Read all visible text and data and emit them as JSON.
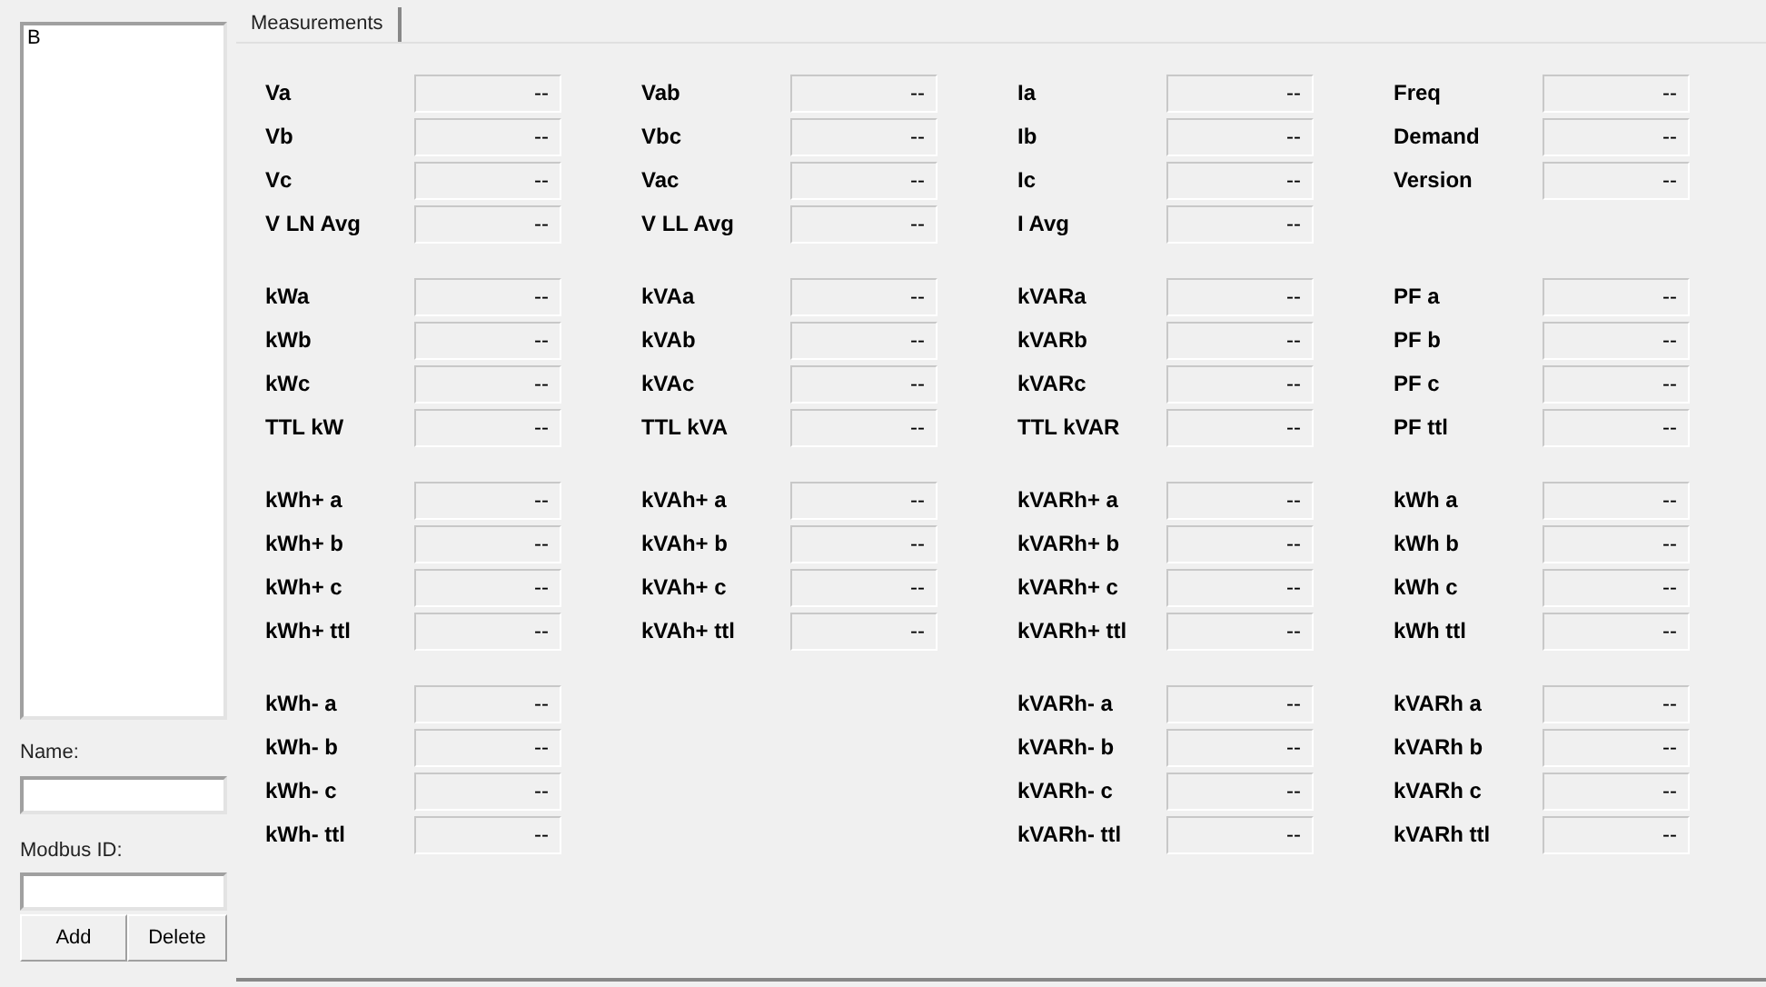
{
  "device_list": {
    "items": [
      {
        "label": "B",
        "selected": false
      }
    ]
  },
  "name_field": {
    "label": "Name:"
  },
  "modbus_field": {
    "label": "Modbus ID:"
  },
  "buttons": [
    "Add",
    "Delete"
  ],
  "tabs": [
    {
      "label": "Measurements",
      "selected": true
    }
  ],
  "groups": [
    {
      "columns": [
        {
          "fields": [
            {
              "label": "Va",
              "value": "--"
            },
            {
              "label": "Vb",
              "value": "--"
            },
            {
              "label": "Vc",
              "value": "--"
            },
            {
              "label": "V LN Avg",
              "value": "--"
            }
          ]
        },
        {
          "fields": [
            {
              "label": "Vab",
              "value": "--"
            },
            {
              "label": "Vbc",
              "value": "--"
            },
            {
              "label": "Vac",
              "value": "--"
            },
            {
              "label": "V LL Avg",
              "value": "--"
            }
          ]
        },
        {
          "fields": [
            {
              "label": "Ia",
              "value": "--"
            },
            {
              "label": "Ib",
              "value": "--"
            },
            {
              "label": "Ic",
              "value": "--"
            },
            {
              "label": "I Avg",
              "value": "--"
            }
          ]
        },
        {
          "fields": [
            {
              "label": "Freq",
              "value": "--"
            },
            {
              "label": "Demand",
              "value": "--"
            },
            {
              "label": "Version",
              "value": "--"
            }
          ]
        }
      ]
    },
    {
      "columns": [
        {
          "fields": [
            {
              "label": "kWa",
              "value": "--"
            },
            {
              "label": "kWb",
              "value": "--"
            },
            {
              "label": "kWc",
              "value": "--"
            },
            {
              "label": "TTL kW",
              "value": "--"
            }
          ]
        },
        {
          "fields": [
            {
              "label": "kVAa",
              "value": "--"
            },
            {
              "label": "kVAb",
              "value": "--"
            },
            {
              "label": "kVAc",
              "value": "--"
            },
            {
              "label": "TTL kVA",
              "value": "--"
            }
          ]
        },
        {
          "fields": [
            {
              "label": "kVARa",
              "value": "--"
            },
            {
              "label": "kVARb",
              "value": "--"
            },
            {
              "label": "kVARc",
              "value": "--"
            },
            {
              "label": "TTL kVAR",
              "value": "--"
            }
          ]
        },
        {
          "fields": [
            {
              "label": "PF a",
              "value": "--"
            },
            {
              "label": "PF b",
              "value": "--"
            },
            {
              "label": "PF c",
              "value": "--"
            },
            {
              "label": "PF ttl",
              "value": "--"
            }
          ]
        }
      ]
    },
    {
      "columns": [
        {
          "fields": [
            {
              "label": "kWh+ a",
              "value": "--"
            },
            {
              "label": "kWh+ b",
              "value": "--"
            },
            {
              "label": "kWh+ c",
              "value": "--"
            },
            {
              "label": "kWh+ ttl",
              "value": "--"
            }
          ]
        },
        {
          "fields": [
            {
              "label": "kVAh+ a",
              "value": "--"
            },
            {
              "label": "kVAh+ b",
              "value": "--"
            },
            {
              "label": "kVAh+ c",
              "value": "--"
            },
            {
              "label": "kVAh+ ttl",
              "value": "--"
            }
          ]
        },
        {
          "fields": [
            {
              "label": "kVARh+ a",
              "value": "--"
            },
            {
              "label": "kVARh+ b",
              "value": "--"
            },
            {
              "label": "kVARh+ c",
              "value": "--"
            },
            {
              "label": "kVARh+ ttl",
              "value": "--"
            }
          ]
        },
        {
          "fields": [
            {
              "label": "kWh a",
              "value": "--"
            },
            {
              "label": "kWh b",
              "value": "--"
            },
            {
              "label": "kWh c",
              "value": "--"
            },
            {
              "label": "kWh ttl",
              "value": "--"
            }
          ]
        }
      ]
    },
    {
      "columns": [
        {
          "fields": [
            {
              "label": "kWh- a",
              "value": "--"
            },
            {
              "label": "kWh- b",
              "value": "--"
            },
            {
              "label": "kWh- c",
              "value": "--"
            },
            {
              "label": "kWh- ttl",
              "value": "--"
            }
          ]
        },
        {},
        {
          "fields": [
            {
              "label": "kVARh- a",
              "value": "--"
            },
            {
              "label": "kVARh- b",
              "value": "--"
            },
            {
              "label": "kVARh- c",
              "value": "--"
            },
            {
              "label": "kVARh- ttl",
              "value": "--"
            }
          ]
        },
        {
          "fields": [
            {
              "label": "kVARh a",
              "value": "--"
            },
            {
              "label": "kVARh b",
              "value": "--"
            },
            {
              "label": "kVARh c",
              "value": "--"
            },
            {
              "label": "kVARh ttl",
              "value": "--"
            }
          ]
        }
      ]
    }
  ]
}
